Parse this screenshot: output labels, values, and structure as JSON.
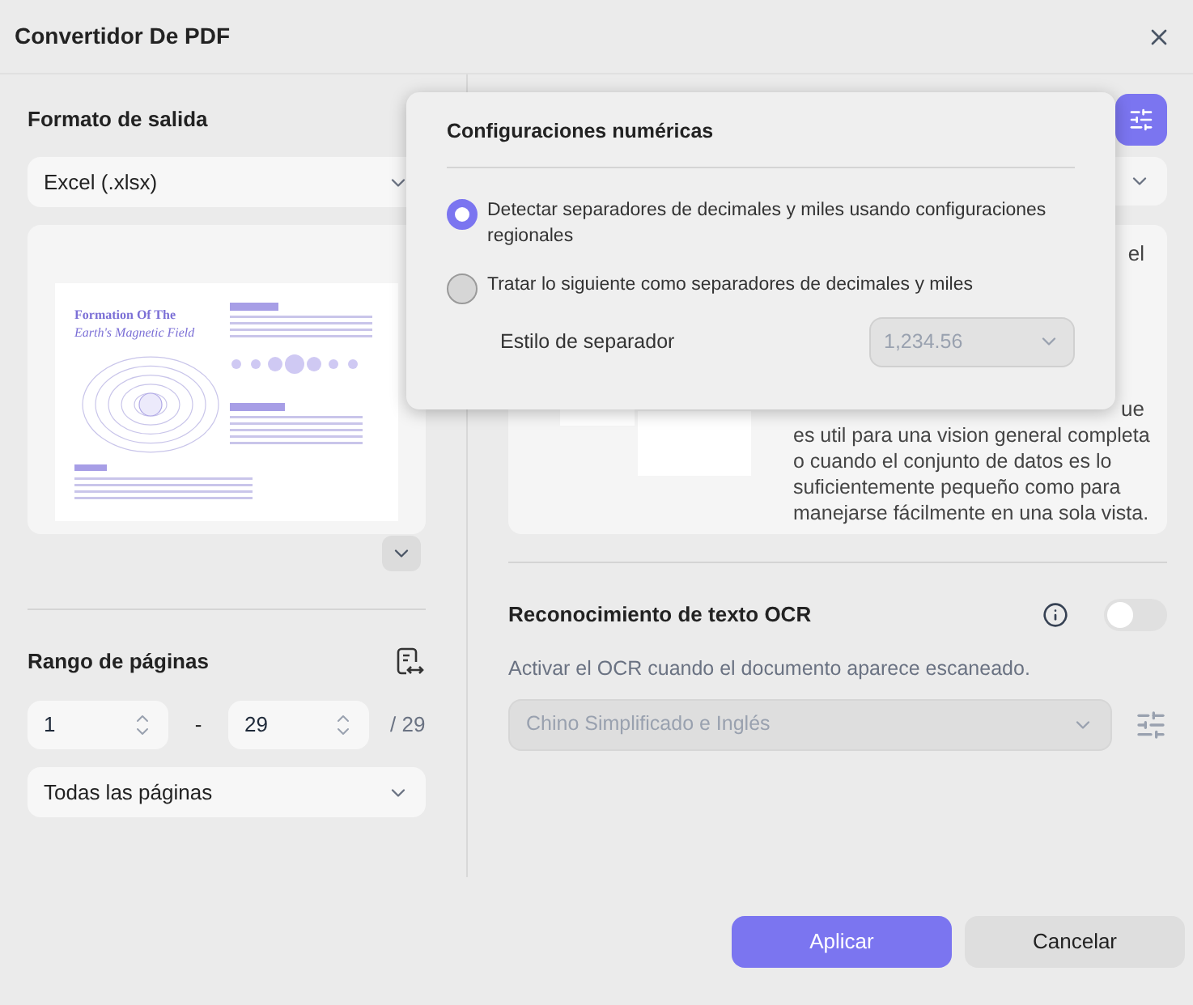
{
  "window": {
    "title": "Convertidor De PDF"
  },
  "output_format": {
    "heading": "Formato de salida",
    "value": "Excel (.xlsx)"
  },
  "preview": {
    "title_line_1": "Formation Of The",
    "title_line_2": "Earth's Magnetic Field"
  },
  "page_range": {
    "heading": "Rango de páginas",
    "from": "1",
    "separator": "-",
    "to": "29",
    "total": "/ 29",
    "mode": "Todas las páginas"
  },
  "background_panel": {
    "fragment_1": "el",
    "fragment_2": "ue",
    "description": "es util para una vision general completa o cuando el conjunto de datos es lo suficientemente pequeño como para manejarse fácilmente en una sola vista."
  },
  "ocr": {
    "heading": "Reconocimiento de texto OCR",
    "on": false,
    "description": "Activar el OCR cuando el documento aparece escaneado.",
    "language": "Chino Simplificado e Inglés",
    "disabled": true
  },
  "number_settings": {
    "title": "Configuraciones numéricas",
    "options": [
      {
        "label": "Detectar separadores de decimales y miles usando configuraciones regionales",
        "selected": true
      },
      {
        "label": "Tratar lo siguiente como separadores de decimales y miles",
        "selected": false
      }
    ],
    "separator_label": "Estilo de separador",
    "separator_value": "1,234.56",
    "separator_disabled": true
  },
  "buttons": [
    {
      "label": "Aplicar",
      "kind": "primary"
    },
    {
      "label": "Cancelar",
      "kind": "secondary"
    }
  ]
}
